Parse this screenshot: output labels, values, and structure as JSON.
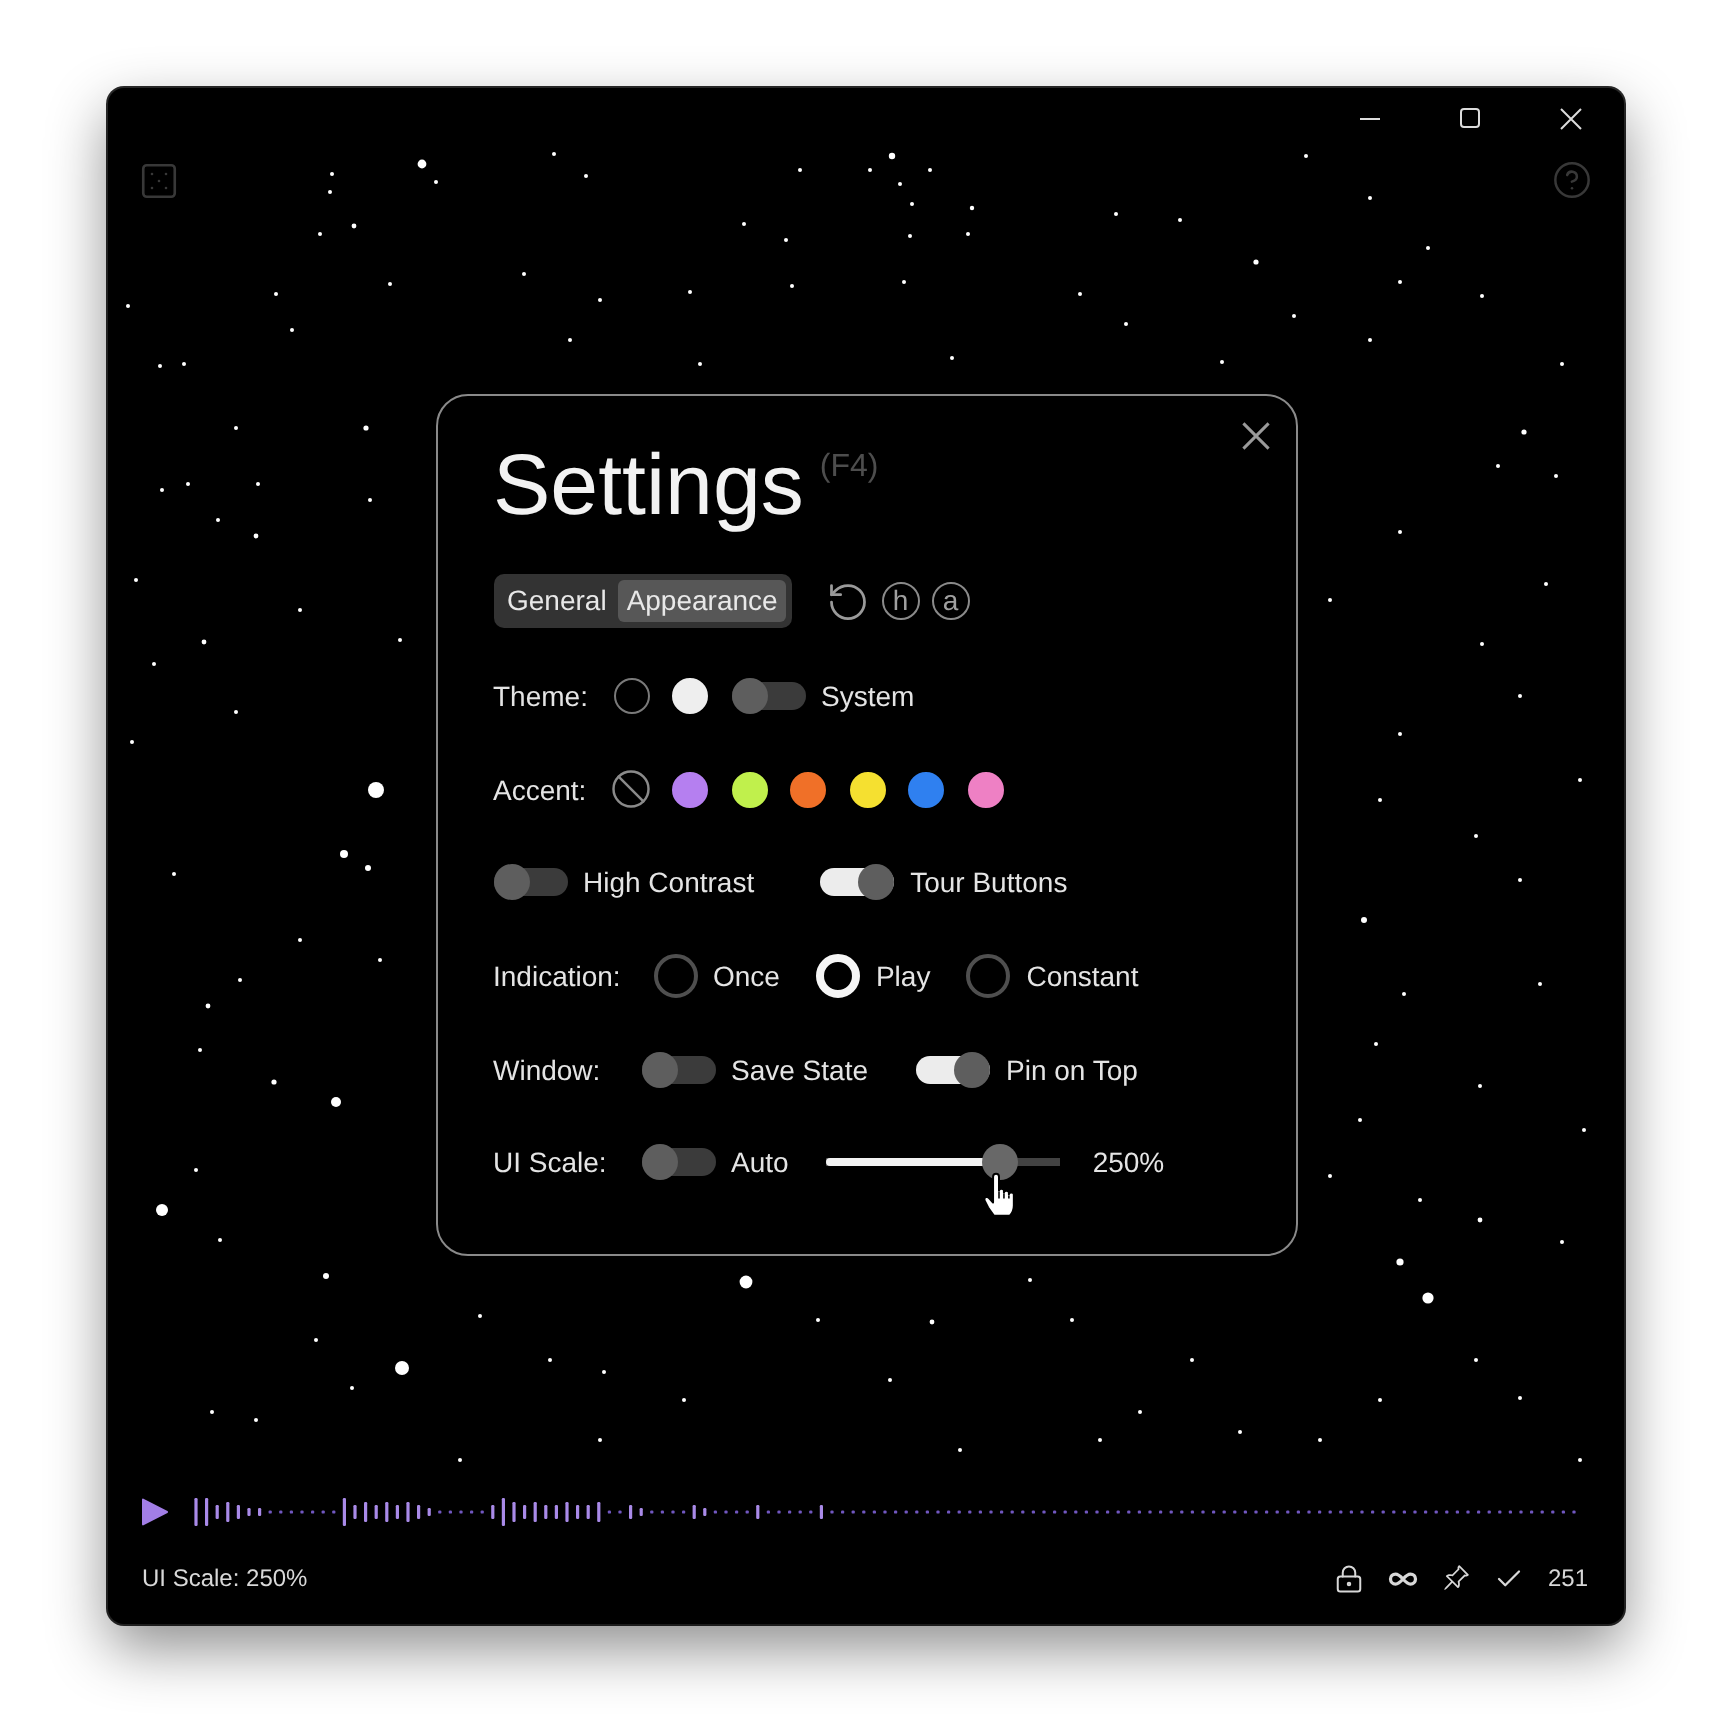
{
  "settings": {
    "title": "Settings",
    "shortcut": "(F4)",
    "tabs": [
      {
        "label": "General",
        "selected": false
      },
      {
        "label": "Appearance",
        "selected": true
      }
    ],
    "letter_buttons": [
      "h",
      "a"
    ],
    "theme": {
      "label": "Theme:",
      "swatches": [
        {
          "color": "#000000"
        },
        {
          "color": "#eeeeee"
        }
      ],
      "system": {
        "label": "System",
        "on": false
      }
    },
    "accent": {
      "label": "Accent:",
      "options": [
        {
          "kind": "none"
        },
        {
          "kind": "color",
          "color": "#b57ff0"
        },
        {
          "kind": "color",
          "color": "#c0f04c"
        },
        {
          "kind": "color",
          "color": "#f07028"
        },
        {
          "kind": "color",
          "color": "#f5e030"
        },
        {
          "kind": "color",
          "color": "#2f80f0"
        },
        {
          "kind": "color",
          "color": "#ee80c4"
        }
      ]
    },
    "switches": [
      {
        "label": "High Contrast",
        "on": false
      },
      {
        "label": "Tour Buttons",
        "on": true
      }
    ],
    "indication": {
      "label": "Indication:",
      "options": [
        {
          "label": "Once",
          "selected": false
        },
        {
          "label": "Play",
          "selected": true
        },
        {
          "label": "Constant",
          "selected": false
        }
      ]
    },
    "window": {
      "label": "Window:",
      "switches": [
        {
          "label": "Save State",
          "on": false
        },
        {
          "label": "Pin on Top",
          "on": true
        }
      ]
    },
    "ui_scale": {
      "label": "UI Scale:",
      "auto": {
        "label": "Auto",
        "on": false
      },
      "slider": {
        "level": 0.74
      },
      "reading": "250%"
    }
  },
  "status_bar": {
    "text": "UI Scale: 250%",
    "count": "251"
  }
}
